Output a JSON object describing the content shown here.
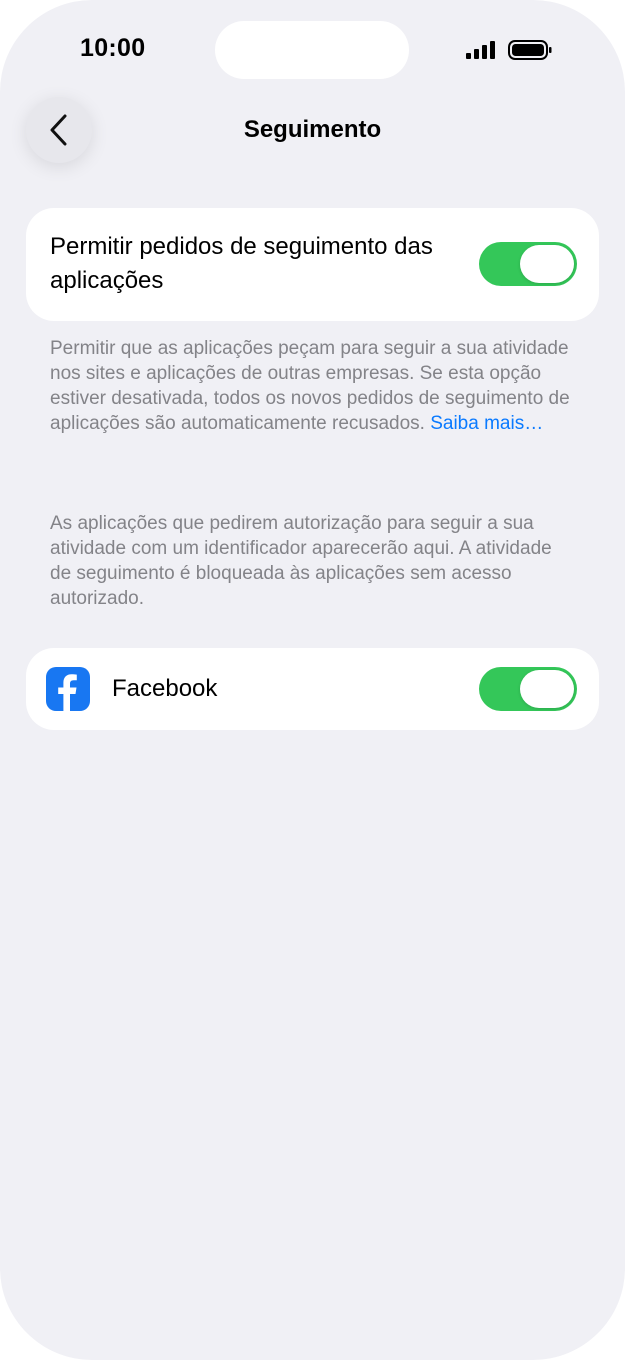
{
  "status_bar": {
    "time": "10:00"
  },
  "header": {
    "title": "Seguimento"
  },
  "tracking": {
    "label": "Permitir pedidos de seguimento das aplicações",
    "enabled": true
  },
  "footnote_1": {
    "text": "Permitir que as aplicações peçam para seguir a sua atividade nos sites e aplicações de outras empresas. Se esta opção estiver desativada, todos os novos pedidos de seguimento de aplicações são automaticamente recusados. ",
    "link": "Saiba mais…"
  },
  "footnote_2": {
    "text": "As aplicações que pedirem autorização para seguir a sua atividade com um identificador aparecerão aqui. A atividade de seguimento é bloqueada às aplicações sem acesso autorizado."
  },
  "apps": [
    {
      "name": "Facebook",
      "icon": "facebook-icon",
      "enabled": true
    }
  ],
  "colors": {
    "background": "#f0f0f5",
    "toggle_on": "#34c759",
    "link": "#0a7aff",
    "facebook": "#1877f2"
  }
}
